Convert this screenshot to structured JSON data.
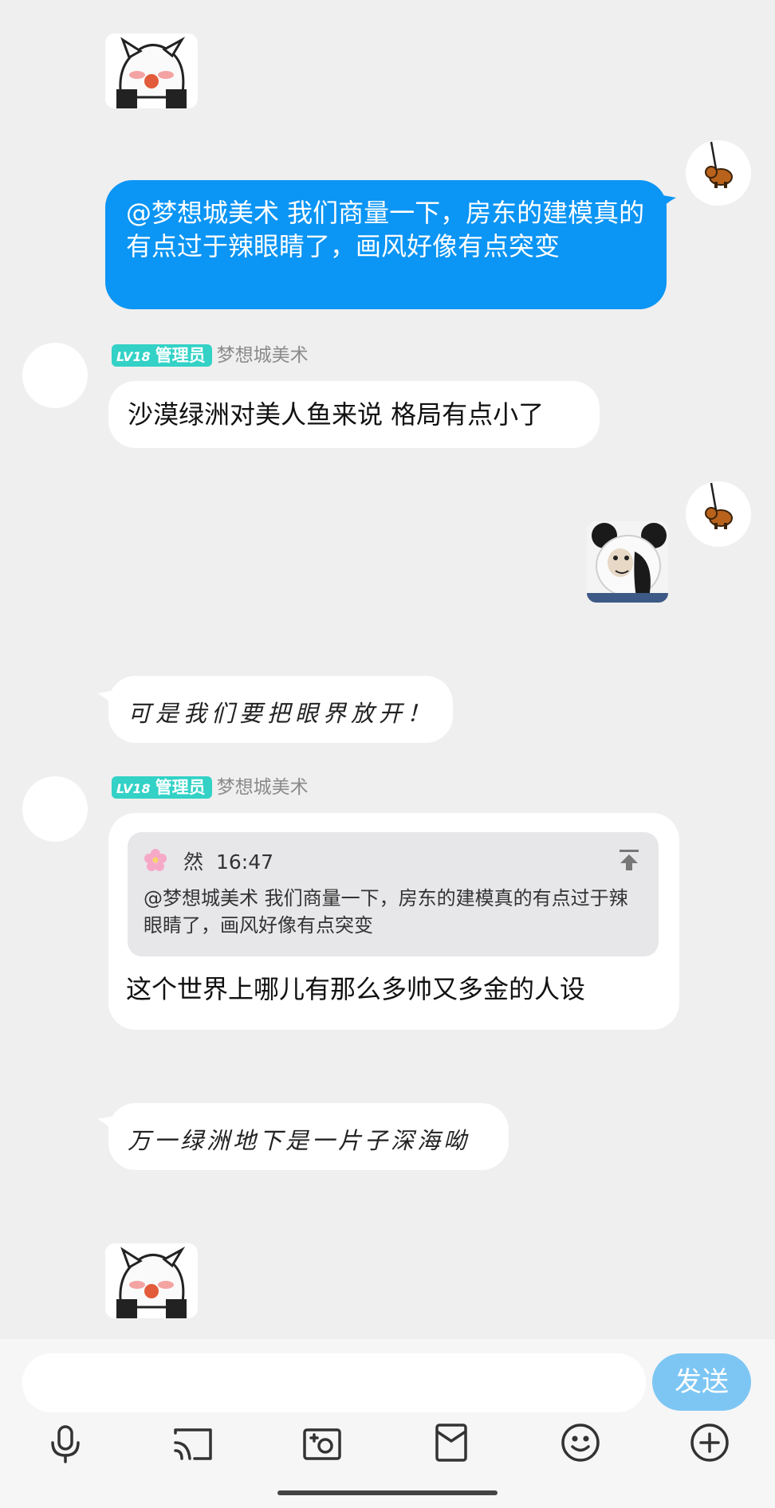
{
  "messages": {
    "m1_text": "@梦想城美术 我们商量一下，房东的建模真的有点过于辣眼睛了，画风好像有点突变",
    "m2_level": "LV18",
    "m2_role": "管理员",
    "m2_sender": "梦想城美术",
    "m2_text": "沙漠绿洲对美人鱼来说 格局有点小了",
    "m3_text": "可是我们要把眼界放开！",
    "m4_level": "LV18",
    "m4_role": "管理员",
    "m4_sender": "梦想城美术",
    "m4_quote_name": "然",
    "m4_quote_time": "16:47",
    "m4_quote_text": "@梦想城美术 我们商量一下，房东的建模真的有点过于辣眼睛了，画风好像有点突变",
    "m4_text": "这个世界上哪儿有那么多帅又多金的人设",
    "m5_text": "万一绿洲地下是一片子深海呦"
  },
  "input": {
    "placeholder": "",
    "send_label": "发送"
  },
  "toolbar": [
    "mic-icon",
    "screen-cast-icon",
    "camera-icon",
    "red-packet-icon",
    "emoji-icon",
    "plus-icon"
  ],
  "colors": {
    "background": "#efefef",
    "my_bubble": "#0b95f4",
    "badge": "#33d1c6",
    "send_button": "#7dc6f4"
  }
}
